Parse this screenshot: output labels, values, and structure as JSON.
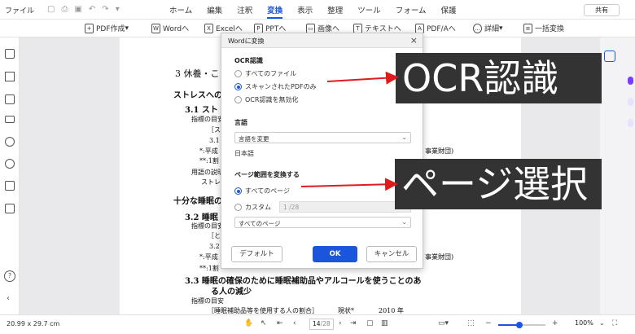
{
  "menubar": {
    "file": "ファイル",
    "items": [
      "ホーム",
      "編集",
      "注釈",
      "変換",
      "表示",
      "整理",
      "ツール",
      "フォーム",
      "保護"
    ],
    "active_index": 3,
    "shared": "共有"
  },
  "toolbar": {
    "pdf_create": "PDF作成",
    "word": "Wordへ",
    "excel": "Excelへ",
    "ppt": "PPTへ",
    "image": "画像へ",
    "text": "テキストへ",
    "pdfa": "PDF/Aへ",
    "more": "詳細",
    "batch": "一括変換"
  },
  "page": {
    "heading": "3 休養・こ",
    "l1": "ストレスへの",
    "l2": "3.1 スト",
    "l3": "指標の目安",
    "l4": "［ス",
    "l5": "3.1",
    "l6": "*:平成",
    "l7": "**:1割",
    "l8": "用語の説明",
    "l9": "ストレ",
    "l10": "十分な睡眠の",
    "l11": "3.2 睡眠",
    "l12": "指標の目安",
    "l13": "［とれ",
    "l14": "3.2",
    "l15": "*:平成",
    "l16": "**:1割",
    "r1": "事業財団)",
    "r2": "事業財団)",
    "h33a": "3.3  睡眠の確保のために睡眠補助品やアルコールを使うことのあ",
    "h33b": "る人の減少",
    "l17": "指標の目安",
    "l18": "［睡眠補助品等を使用する人の割合］",
    "l19": "現状*",
    "l20": "2010 年"
  },
  "dialog": {
    "title": "Wordに変換",
    "ocr_section": "OCR認識",
    "ocr_options": [
      "すべてのファイル",
      "スキャンされたPDFのみ",
      "OCR認識を無効化"
    ],
    "ocr_selected": 1,
    "lang_section": "言語",
    "lang_select": "言語を変更",
    "lang_value": "日本語",
    "range_section": "ページ範囲を変換する",
    "range_all": "すべてのページ",
    "range_custom": "カスタム",
    "range_placeholder": "1 /28",
    "range_select": "すべてのページ",
    "btn_default": "デフォルト",
    "btn_ok": "OK",
    "btn_cancel": "キャンセル"
  },
  "callouts": {
    "ocr": "OCR認識",
    "page": "ページ選択"
  },
  "status": {
    "dimensions": "20.99 x 29.7 cm",
    "page_current": "14",
    "page_total": "/28",
    "zoom": "100%",
    "zoom_level": 0.45
  },
  "colors": {
    "accent": "#1a56db",
    "callout_bg": "#333333",
    "arrow": "#e01b1b"
  }
}
